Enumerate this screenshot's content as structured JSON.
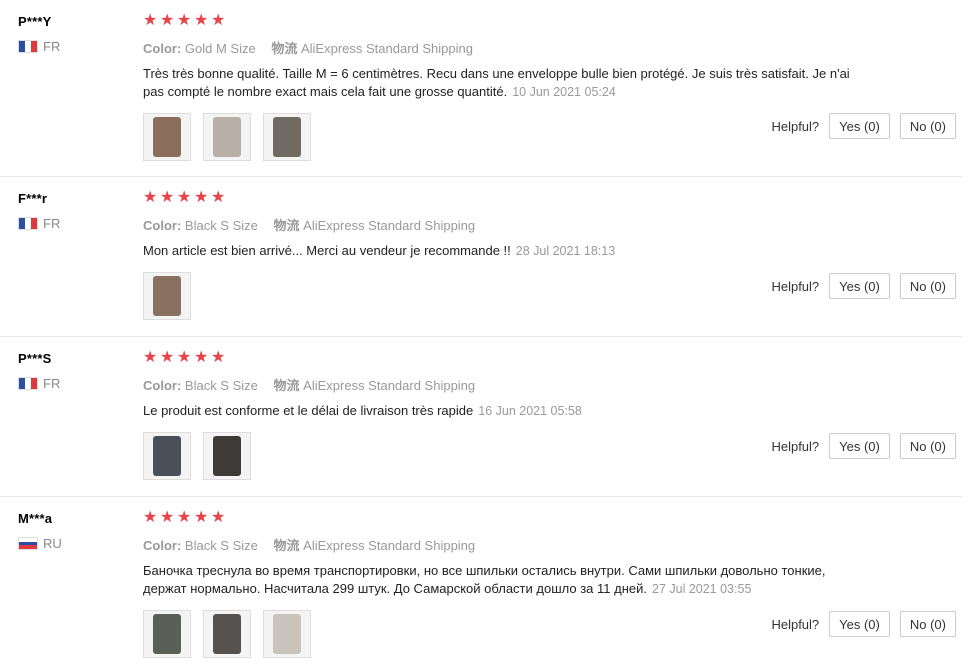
{
  "helpful_label": "Helpful?",
  "reviews": [
    {
      "user": "P***Y",
      "country": "FR",
      "color_label": "Color:",
      "color_value": "Gold M Size",
      "shipping_label": "物流",
      "shipping_value": "AliExpress Standard Shipping",
      "text": "Très très bonne qualité. Taille M = 6 centimètres. Recu dans une enveloppe bulle bien protégé. Je suis très satisfait. Je n'ai pas compté le nombre exact mais cela fait une grosse quantité.",
      "date": "10 Jun 2021 05:24",
      "yes": "Yes (0)",
      "no": "No (0)",
      "photos": [
        "#8a6d5a",
        "#b8b0a6",
        "#6f6a62"
      ]
    },
    {
      "user": "F***r",
      "country": "FR",
      "color_label": "Color:",
      "color_value": "Black S Size",
      "shipping_label": "物流",
      "shipping_value": "AliExpress Standard Shipping",
      "text": "Mon article est bien arrivé... Merci au vendeur je recommande !!",
      "date": "28 Jul 2021 18:13",
      "yes": "Yes (0)",
      "no": "No (0)",
      "photos": [
        "#8a7060"
      ]
    },
    {
      "user": "P***S",
      "country": "FR",
      "color_label": "Color:",
      "color_value": "Black S Size",
      "shipping_label": "物流",
      "shipping_value": "AliExpress Standard Shipping",
      "text": "Le produit est conforme et le délai de livraison très rapide",
      "date": "16 Jun 2021 05:58",
      "yes": "Yes (0)",
      "no": "No (0)",
      "photos": [
        "#4a4f5a",
        "#3d3a38"
      ]
    },
    {
      "user": "M***a",
      "country": "RU",
      "color_label": "Color:",
      "color_value": "Black S Size",
      "shipping_label": "物流",
      "shipping_value": "AliExpress Standard Shipping",
      "text": "Баночка треснула во время транспортировки, но все шпильки остались внутри. Сами шпильки довольно тонкие, держат нормально. Насчитала 299 штук. До Самарской области дошло за 11 дней.",
      "date": "27 Jul 2021 03:55",
      "yes": "Yes (0)",
      "no": "No (0)",
      "photos": [
        "#5a6058",
        "#55524f",
        "#c9c4bc"
      ]
    }
  ],
  "flag_colors": {
    "FR": [
      "#2b4ea2",
      "#ffffff",
      "#e0383e"
    ],
    "RU": [
      "#ffffff",
      "#2b4ea2",
      "#e0383e"
    ]
  }
}
